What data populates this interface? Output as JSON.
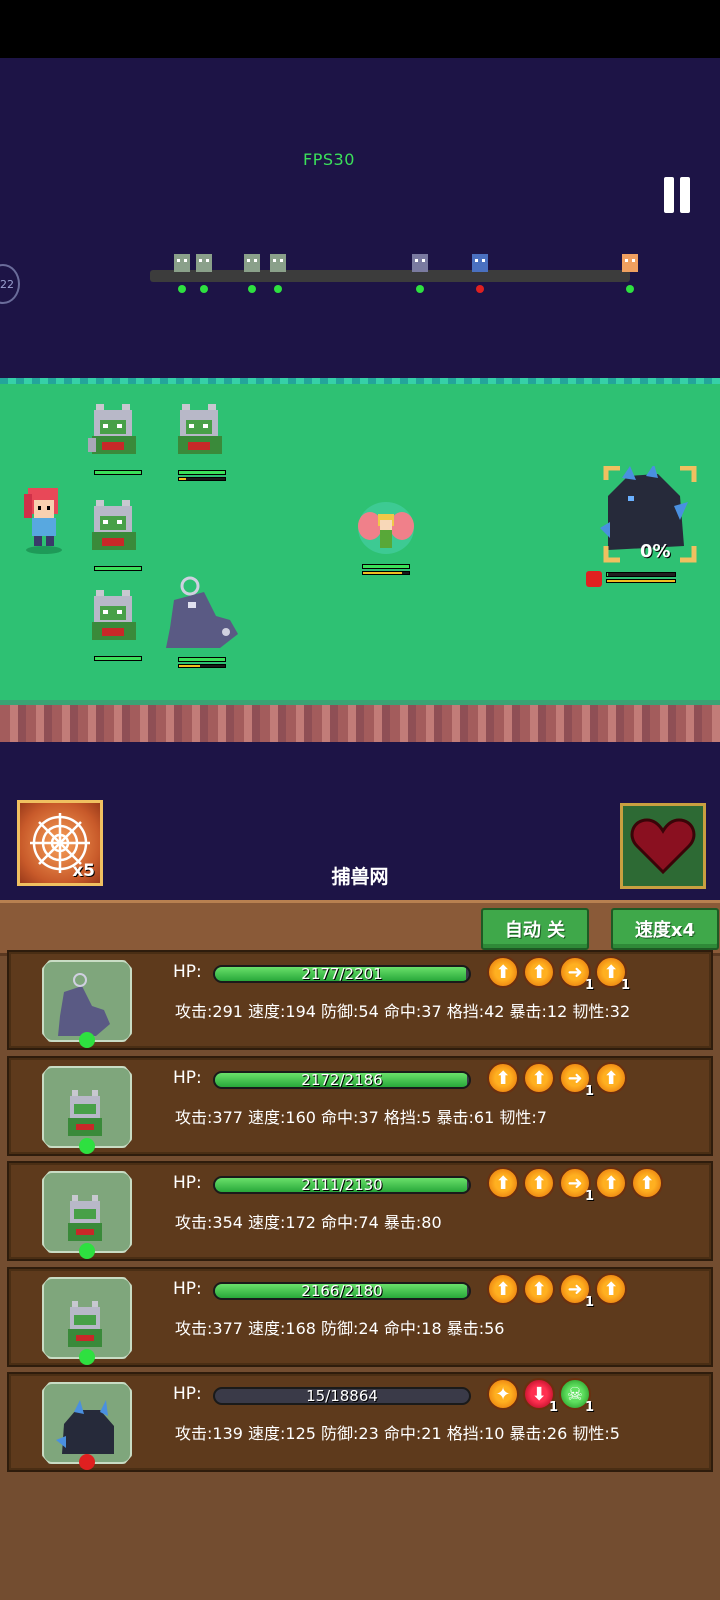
{
  "hud": {
    "fps": "FPS30",
    "side_badge": "22",
    "pause_icon": "pause-icon"
  },
  "turn_order": [
    {
      "name": "zombie-cat-icon",
      "status": "ally"
    },
    {
      "name": "zombie-cat-icon",
      "status": "ally"
    },
    {
      "name": "zombie-cat-icon",
      "status": "ally"
    },
    {
      "name": "zombie-cat-icon",
      "status": "ally"
    },
    {
      "name": "ghost-beast-icon",
      "status": "ally"
    },
    {
      "name": "crystal-wolf-icon",
      "status": "enemy"
    },
    {
      "name": "fairy-icon",
      "status": "ally"
    }
  ],
  "battlefield": {
    "boss_capture_label": "0%",
    "colors": {
      "grass": "#2ec173",
      "sky": "#1d1446",
      "ally_dot": "#2ee040",
      "enemy_dot": "#e02020"
    }
  },
  "skills": {
    "net_count": "x5",
    "net_label": "捕兽网",
    "net_icon": "spider-web-icon",
    "heart_icon": "heart-icon"
  },
  "controls": {
    "auto_label": "自动 关",
    "speed_label": "速度x4"
  },
  "units": [
    {
      "portrait": "ghost-beast-portrait",
      "hp_label": "HP:",
      "hp_text": "2177/2201",
      "hp_fraction": 0.989,
      "stats": "攻击:291 速度:194 防御:54 命中:37 格挡:42 暴击:12 韧性:32",
      "status": "ally",
      "buffs": [
        {
          "type": "up",
          "icon": "arrow-up-icon",
          "stack": ""
        },
        {
          "type": "up",
          "icon": "arrow-up-icon",
          "stack": ""
        },
        {
          "type": "up",
          "icon": "bird-icon",
          "stack": "1"
        },
        {
          "type": "up",
          "icon": "arrow-up-icon",
          "stack": "1"
        }
      ]
    },
    {
      "portrait": "zombie-cat-portrait",
      "hp_label": "HP:",
      "hp_text": "2172/2186",
      "hp_fraction": 0.994,
      "stats": "攻击:377 速度:160 命中:37 格挡:5 暴击:61 韧性:7",
      "status": "ally",
      "buffs": [
        {
          "type": "up",
          "icon": "arrow-up-icon",
          "stack": ""
        },
        {
          "type": "up",
          "icon": "arrow-up-icon",
          "stack": ""
        },
        {
          "type": "up",
          "icon": "bird-icon",
          "stack": "1"
        },
        {
          "type": "up",
          "icon": "arrow-up-icon",
          "stack": ""
        }
      ]
    },
    {
      "portrait": "zombie-cat-portrait",
      "hp_label": "HP:",
      "hp_text": "2111/2130",
      "hp_fraction": 0.991,
      "stats": "攻击:354 速度:172 命中:74 暴击:80",
      "status": "ally",
      "buffs": [
        {
          "type": "up",
          "icon": "arrow-up-icon",
          "stack": ""
        },
        {
          "type": "up",
          "icon": "arrow-up-icon",
          "stack": ""
        },
        {
          "type": "up",
          "icon": "bird-icon",
          "stack": "1"
        },
        {
          "type": "up",
          "icon": "arrow-up-icon",
          "stack": ""
        },
        {
          "type": "up",
          "icon": "arrow-up-icon",
          "stack": ""
        }
      ]
    },
    {
      "portrait": "zombie-cat-portrait",
      "hp_label": "HP:",
      "hp_text": "2166/2180",
      "hp_fraction": 0.994,
      "stats": "攻击:377 速度:168 防御:24 命中:18 暴击:56",
      "status": "ally",
      "buffs": [
        {
          "type": "up",
          "icon": "arrow-up-icon",
          "stack": ""
        },
        {
          "type": "up",
          "icon": "arrow-up-icon",
          "stack": ""
        },
        {
          "type": "up",
          "icon": "bird-icon",
          "stack": "1"
        },
        {
          "type": "up",
          "icon": "arrow-up-icon",
          "stack": ""
        }
      ]
    },
    {
      "portrait": "crystal-wolf-portrait",
      "hp_label": "HP:",
      "hp_text": "15/18864",
      "hp_fraction": 0.001,
      "stats": "攻击:139 速度:125 防御:23 命中:21 格挡:10 暴击:26 韧性:5",
      "status": "enemy",
      "buffs": [
        {
          "type": "up",
          "icon": "flame-icon",
          "stack": ""
        },
        {
          "type": "down",
          "icon": "arrow-down-icon",
          "stack": "1"
        },
        {
          "type": "poison",
          "icon": "skull-icon",
          "stack": "1"
        }
      ]
    }
  ]
}
